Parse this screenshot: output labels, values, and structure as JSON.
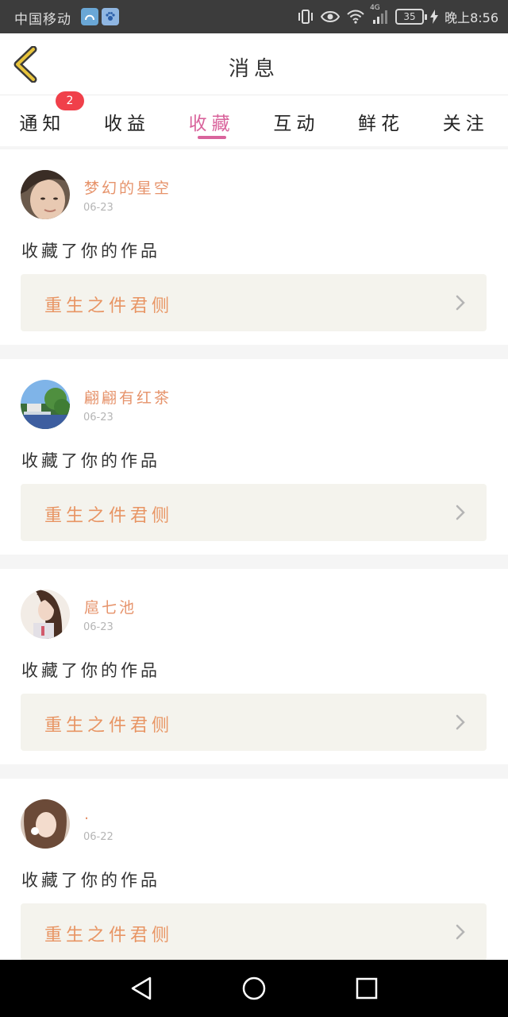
{
  "status_bar": {
    "carrier": "中国移动",
    "network": "4G",
    "battery": "35",
    "time": "晚上8:56",
    "icons": [
      "app-icon",
      "paw-icon",
      "vibrate-icon",
      "eye-icon",
      "wifi-icon",
      "signal-icon",
      "battery-icon",
      "charging-icon"
    ]
  },
  "header": {
    "title": "消息",
    "back_icon": "chevron-left-icon"
  },
  "tabs": [
    {
      "label": "通知",
      "badge": "2",
      "active": false
    },
    {
      "label": "收益",
      "active": false
    },
    {
      "label": "收藏",
      "active": true
    },
    {
      "label": "互动",
      "active": false
    },
    {
      "label": "鲜花",
      "active": false
    },
    {
      "label": "关注",
      "active": false
    }
  ],
  "colors": {
    "accent": "#d9649c",
    "username": "#e6936b",
    "work_title": "#e89564",
    "badge": "#f0404a",
    "card_box": "#f4f3ed"
  },
  "notifications": [
    {
      "user": "梦幻的星空",
      "date": "06-23",
      "action": "收藏了你的作品",
      "work": "重生之件君侧"
    },
    {
      "user": "翩翩有红茶",
      "date": "06-23",
      "action": "收藏了你的作品",
      "work": "重生之件君侧"
    },
    {
      "user": "扈七池",
      "date": "06-23",
      "action": "收藏了你的作品",
      "work": "重生之件君侧"
    },
    {
      "user": ".",
      "date": "06-22",
      "action": "收藏了你的作品",
      "work": "重生之件君侧"
    }
  ],
  "nav_bar": {
    "icons": [
      "nav-back-icon",
      "nav-home-icon",
      "nav-recent-icon"
    ]
  }
}
